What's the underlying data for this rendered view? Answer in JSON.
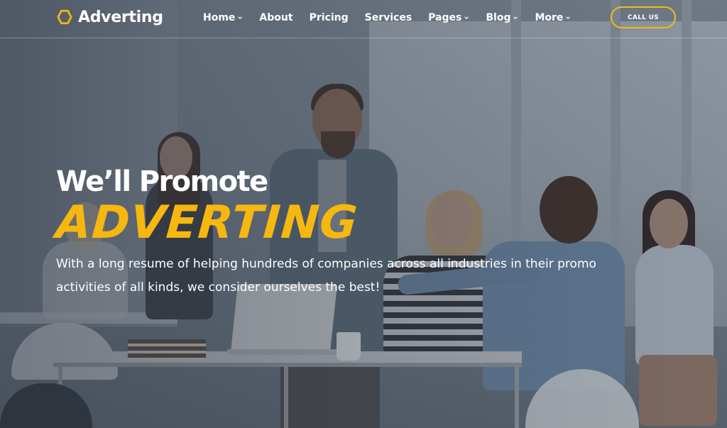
{
  "brand": {
    "name": "Adverting",
    "accent_color": "#f6b80f",
    "logo_icon": "hexagon-icon"
  },
  "nav": {
    "items": [
      {
        "label": "Home",
        "has_dropdown": true
      },
      {
        "label": "About",
        "has_dropdown": false
      },
      {
        "label": "Pricing",
        "has_dropdown": false
      },
      {
        "label": "Services",
        "has_dropdown": false
      },
      {
        "label": "Pages",
        "has_dropdown": true
      },
      {
        "label": "Blog",
        "has_dropdown": true
      },
      {
        "label": "More",
        "has_dropdown": true
      }
    ],
    "cta_label": "CALL US"
  },
  "hero": {
    "headline": "We’ll Promote",
    "brand_word": "ADVERTING",
    "lead": "With a long resume of helping hundreds of companies across all industries in their promo activities of all kinds, we consider ourselves the best!"
  }
}
